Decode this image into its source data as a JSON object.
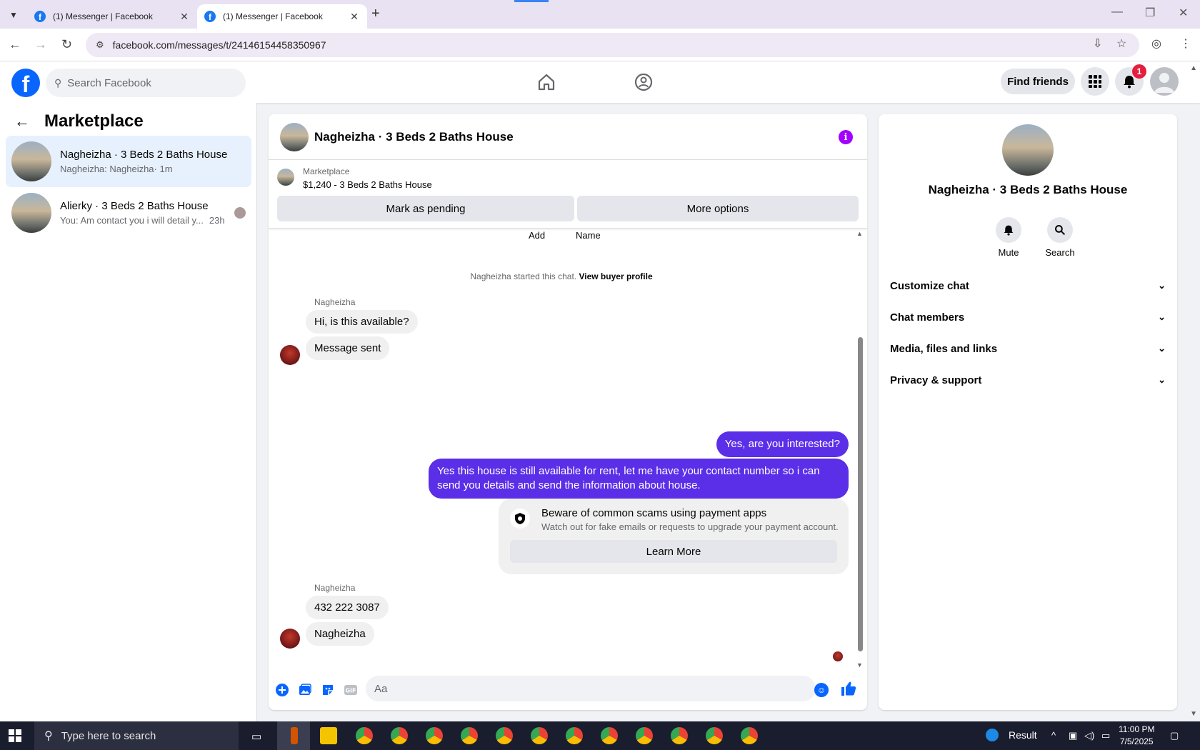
{
  "browser": {
    "tabs": [
      {
        "title": "(1) Messenger | Facebook",
        "favicon": "facebook-icon"
      },
      {
        "title": "(1) Messenger | Facebook",
        "favicon": "facebook-icon"
      }
    ],
    "url": "facebook.com/messages/t/24146154458350967"
  },
  "fb_header": {
    "search_placeholder": "Search Facebook",
    "find_friends": "Find friends",
    "notification_count": "1"
  },
  "left_panel": {
    "title": "Marketplace",
    "conversations": [
      {
        "name": "Nagheizha · 3 Beds 2 Baths House",
        "snippet": "Nagheizha: Nagheizha",
        "time": "· 1m",
        "selected": true
      },
      {
        "name": "Alierky · 3 Beds 2 Baths House",
        "snippet": "You: Am contact you i will detail y...",
        "time": "23h",
        "selected": false
      }
    ]
  },
  "chat": {
    "title": "Nagheizha · 3 Beds 2 Baths House",
    "marketplace_label": "Marketplace",
    "listing": "$1,240 - 3 Beds 2 Baths House",
    "mark_pending": "Mark as pending",
    "more_options": "More options",
    "add_label": "Add",
    "name_label": "Name",
    "system_note": "Nagheizha started this chat.",
    "system_link": "View buyer profile",
    "messages_group1": {
      "sender": "Nagheizha",
      "msgs": [
        "Hi, is this available?",
        "Message sent"
      ]
    },
    "outgoing": [
      "Yes, are you interested?",
      "Yes this house is still available for rent, let me have your contact number so i can send you details and send the information about house."
    ],
    "scam_card": {
      "title": "Beware of common scams using payment apps",
      "body": "Watch out for fake emails or requests to upgrade your payment account.",
      "button": "Learn More"
    },
    "messages_group2": {
      "sender": "Nagheizha",
      "msgs": [
        "432 222 3087",
        "Nagheizha"
      ]
    },
    "composer_placeholder": "Aa"
  },
  "info_panel": {
    "name": "Nagheizha · 3 Beds 2 Baths House",
    "mute": "Mute",
    "search": "Search",
    "sections": [
      "Customize chat",
      "Chat members",
      "Media, files and links",
      "Privacy & support"
    ]
  },
  "taskbar": {
    "search_placeholder": "Type here to search",
    "result_label": "Result",
    "time": "11:00 PM",
    "date": "7/5/2025"
  },
  "colors": {
    "accent_blue": "#0866ff",
    "outgoing_bubble": "#5b2ee8",
    "info_purple": "#a200ff",
    "badge_red": "#e41e3f"
  }
}
